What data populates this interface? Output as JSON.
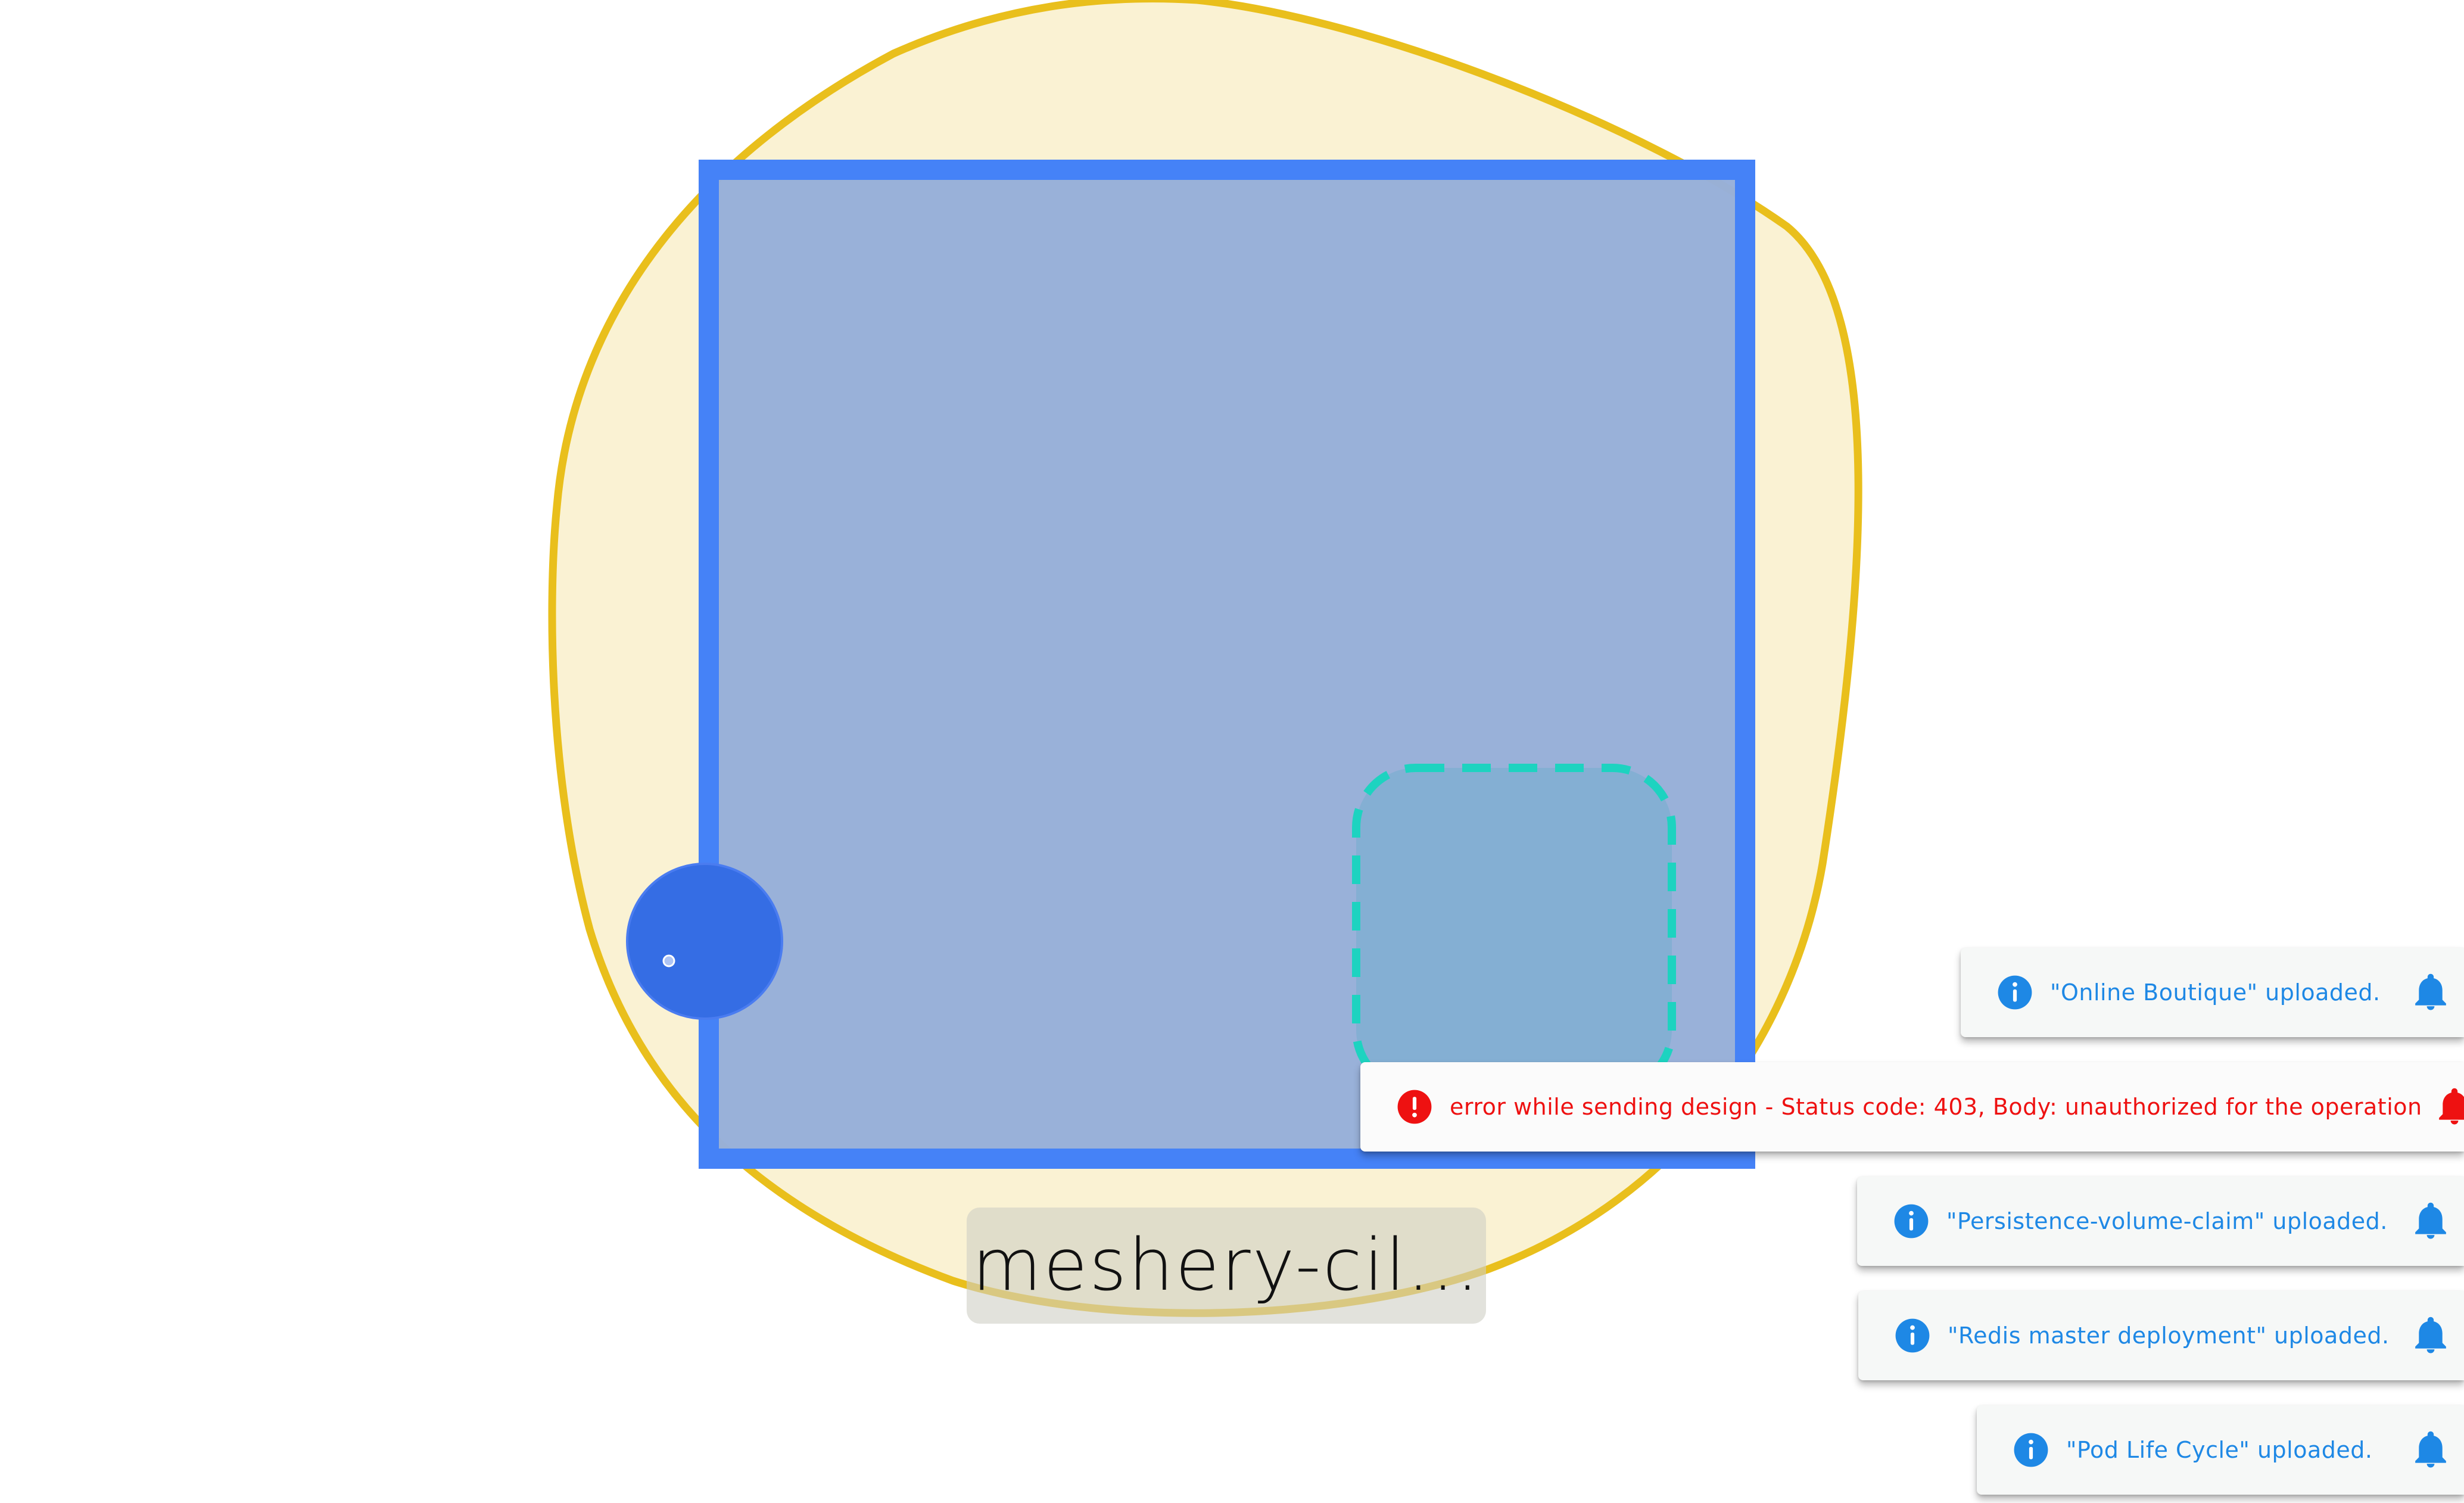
{
  "canvas": {
    "node_label": "meshery-cil...",
    "colors": {
      "namespace_fill": "#faf2d3",
      "namespace_stroke": "#e9bf1c",
      "group_fill": "#97afd9",
      "group_stroke": "#4582f7",
      "dashed_node_fill": "#84afd3",
      "dashed_node_stroke": "#1dd3c0",
      "handle_fill": "#356de4"
    }
  },
  "notifications": [
    {
      "type": "info",
      "icon": "info-icon",
      "message": "\"Online Boutique\" uploaded.",
      "action_icon": "bell-icon"
    },
    {
      "type": "error",
      "icon": "error-icon",
      "message": "error while sending design - Status code: 403, Body: unauthorized for the operation",
      "action_icon": "bell-icon"
    },
    {
      "type": "info",
      "icon": "info-icon",
      "message": "\"Persistence-volume-claim\" uploaded.",
      "action_icon": "bell-icon"
    },
    {
      "type": "info",
      "icon": "info-icon",
      "message": "\"Redis master deployment\" uploaded.",
      "action_icon": "bell-icon"
    },
    {
      "type": "info",
      "icon": "info-icon",
      "message": "\"Pod Life Cycle\" uploaded.",
      "action_icon": "bell-icon"
    }
  ],
  "colors": {
    "info": "#1e88e5",
    "error": "#ee1111",
    "toast_background": "#f6f8f7"
  }
}
